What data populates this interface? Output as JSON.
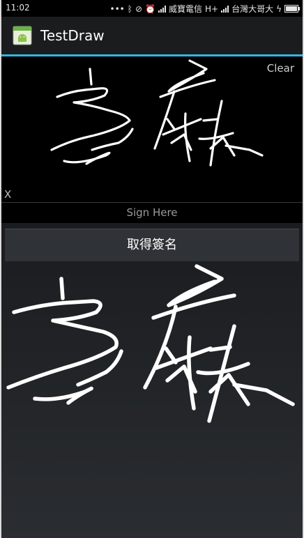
{
  "status_bar": {
    "time": "11:02",
    "carrier_1": "威寶電信",
    "network_1": "H+",
    "carrier_2": "台灣大哥大",
    "icons": [
      "dots-icon",
      "bluetooth-icon",
      "mute-icon",
      "alarm-icon",
      "signal-icon",
      "signal-icon",
      "charging-icon",
      "battery-icon"
    ]
  },
  "action_bar": {
    "title": "TestDraw"
  },
  "pad": {
    "clear_label": "Clear",
    "x_label": "X",
    "hint": "Sign Here"
  },
  "actions": {
    "get_signature_label": "取得簽名"
  },
  "colors": {
    "accent": "#33b5e5",
    "stroke": "#ffffff",
    "app_icon": "#8bc34a"
  }
}
